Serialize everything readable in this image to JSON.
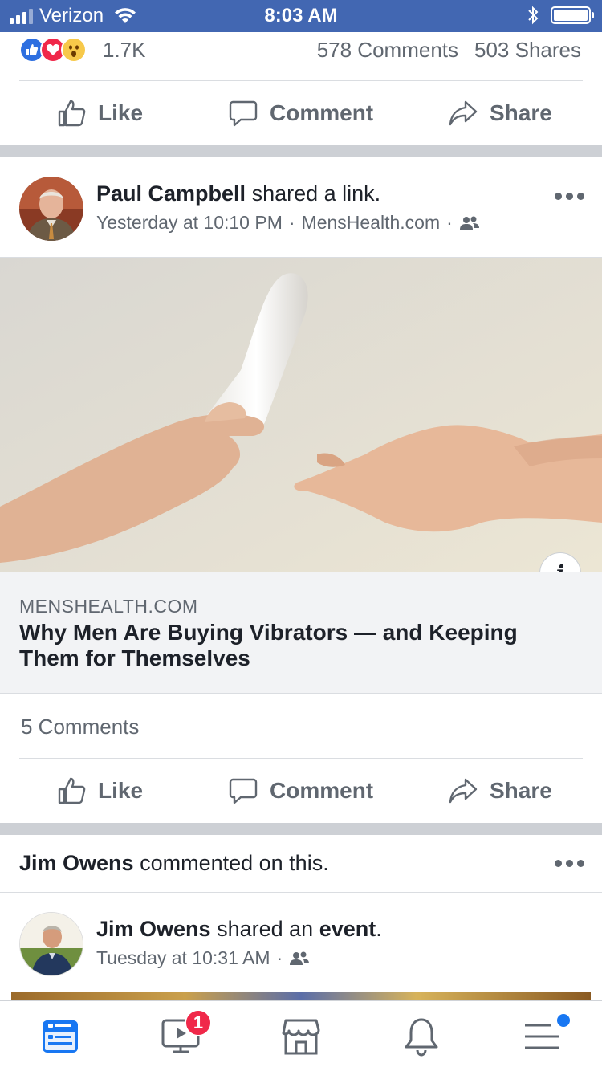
{
  "status_bar": {
    "carrier": "Verizon",
    "time": "8:03 AM",
    "icons": [
      "signal-icon",
      "wifi-icon",
      "bluetooth-icon",
      "battery-icon"
    ]
  },
  "prev_post": {
    "reaction_count": "1.7K",
    "reactions": [
      "like-reaction-icon",
      "love-reaction-icon",
      "wow-reaction-icon"
    ],
    "comments": "578 Comments",
    "shares": "503 Shares"
  },
  "actions": {
    "like": "Like",
    "comment": "Comment",
    "share": "Share"
  },
  "post": {
    "author": "Paul Campbell",
    "action_text": "shared a link.",
    "time": "Yesterday at 10:10 PM",
    "sep": "·",
    "source": "MensHealth.com",
    "audience_icon": "friends-icon",
    "link": {
      "domain": "MENSHEALTH.COM",
      "title": "Why Men Are Buying Vibrators — and Keeping Them for Themselves",
      "info_label": "i"
    },
    "comments": "5 Comments"
  },
  "story2": {
    "commenter": "Jim Owens",
    "commented_text": "commented on this.",
    "author": "Jim Owens",
    "action_text": "shared an",
    "event_word": "event",
    "period": ".",
    "time": "Tuesday at 10:31 AM",
    "sep": "·"
  },
  "tab_bar": {
    "tabs": [
      "news-feed-tab",
      "watch-tab",
      "marketplace-tab",
      "notifications-tab",
      "menu-tab"
    ],
    "watch_badge": "1"
  },
  "colors": {
    "brand": "#4267b2",
    "active_tab": "#1877f2",
    "badge": "#f02849",
    "secondary_text": "#606770"
  }
}
